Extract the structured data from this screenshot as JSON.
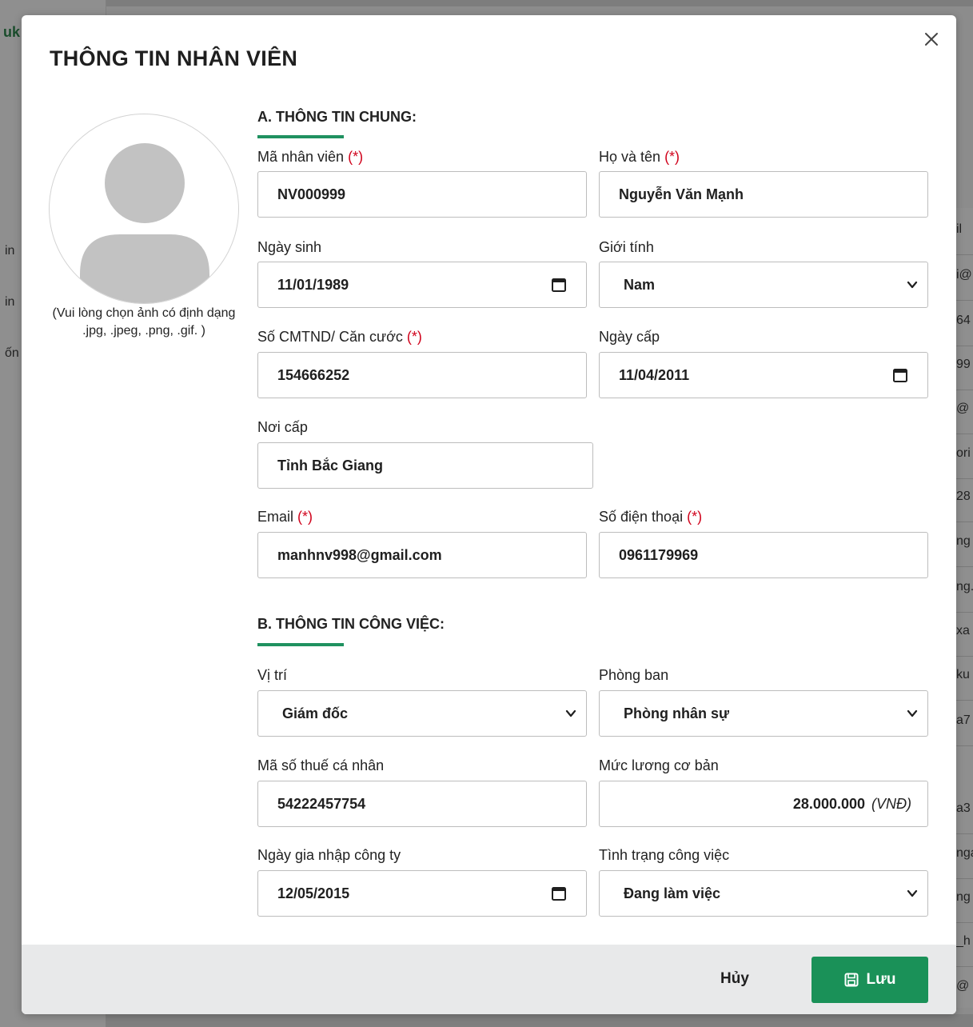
{
  "background": {
    "logo": "uk",
    "sidebar_fragments": [
      "in",
      "in",
      "ốn"
    ],
    "table_fragments": [
      "il",
      "i@",
      "64",
      "99",
      "@",
      "ori",
      "28",
      "ng",
      "ng.",
      "xa",
      "ku",
      "a7",
      "a3",
      "nga",
      "ng",
      "_h",
      "@"
    ]
  },
  "modal": {
    "title": "THÔNG TIN NHÂN VIÊN",
    "avatar_hint": "(Vui lòng chọn ảnh có định dạng .jpg, .jpeg, .png, .gif. )",
    "section_a": "A. THÔNG TIN CHUNG:",
    "section_b": "B. THÔNG TIN CÔNG VIỆC:",
    "required_mark": "(*)",
    "fields": {
      "employee_code": {
        "label": "Mã nhân viên",
        "value": "NV000999"
      },
      "full_name": {
        "label": "Họ và tên",
        "value": "Nguyễn Văn Mạnh"
      },
      "birth_date": {
        "label": "Ngày sinh",
        "value": "11/01/1989"
      },
      "gender": {
        "label": "Giới tính",
        "value": "Nam"
      },
      "id_number": {
        "label": "Số CMTND/ Căn cước",
        "value": "154666252"
      },
      "issue_date": {
        "label": "Ngày cấp",
        "value": "11/04/2011"
      },
      "issue_place": {
        "label": "Nơi cấp",
        "value": "Tỉnh Bắc Giang"
      },
      "email": {
        "label": "Email",
        "value": "manhnv998@gmail.com"
      },
      "phone": {
        "label": "Số điện thoại",
        "value": "0961179969"
      },
      "position": {
        "label": "Vị trí",
        "value": "Giám đốc"
      },
      "department": {
        "label": "Phòng ban",
        "value": "Phòng nhân sự"
      },
      "tax_code": {
        "label": "Mã số thuế cá nhân",
        "value": "54222457754"
      },
      "salary": {
        "label": "Mức lương cơ bản",
        "value": "28.000.000",
        "unit": "(VNĐ)"
      },
      "join_date": {
        "label": "Ngày gia nhập công ty",
        "value": "12/05/2015"
      },
      "work_status": {
        "label": "Tình trạng công việc",
        "value": "Đang làm việc"
      }
    },
    "cancel_label": "Hủy",
    "save_label": "Lưu"
  },
  "colors": {
    "accent": "#1a9158",
    "required": "#d0021b",
    "footer": "#e8e9ea"
  }
}
